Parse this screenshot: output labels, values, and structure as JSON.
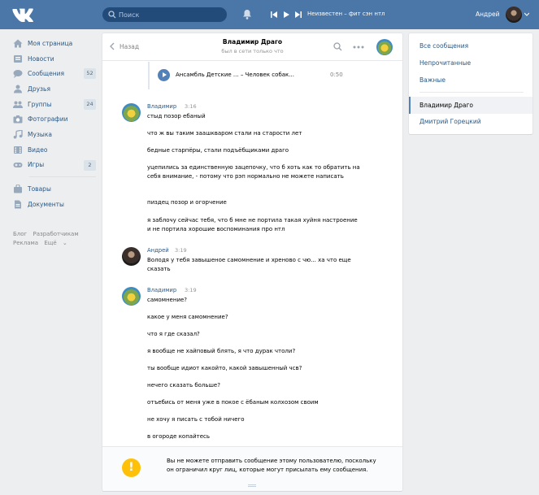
{
  "header": {
    "search_placeholder": "Поиск",
    "now_playing": "Неизвестен – фит сэн нтл",
    "user_name": "Андрей"
  },
  "nav": {
    "items": [
      {
        "label": "Моя страница",
        "icon": "home-icon",
        "count": ""
      },
      {
        "label": "Новости",
        "icon": "news-icon",
        "count": ""
      },
      {
        "label": "Сообщения",
        "icon": "messages-icon",
        "count": "52"
      },
      {
        "label": "Друзья",
        "icon": "friends-icon",
        "count": ""
      },
      {
        "label": "Группы",
        "icon": "groups-icon",
        "count": "24"
      },
      {
        "label": "Фотографии",
        "icon": "camera-icon",
        "count": ""
      },
      {
        "label": "Музыка",
        "icon": "music-icon",
        "count": ""
      },
      {
        "label": "Видео",
        "icon": "video-icon",
        "count": ""
      },
      {
        "label": "Игры",
        "icon": "gamepad-icon",
        "count": "2"
      }
    ],
    "items2": [
      {
        "label": "Товары",
        "icon": "bag-icon"
      },
      {
        "label": "Документы",
        "icon": "document-icon"
      }
    ],
    "footer": {
      "blog": "Блог",
      "developers": "Разработчикам",
      "ads": "Реклама",
      "more": "Ещё"
    }
  },
  "chat": {
    "back_label": "Назад",
    "peer_name": "Владимир Драго",
    "peer_status": "был в сети только что",
    "audio": {
      "title": "Ансамбль Детские ... – Человек собак...",
      "duration": "0:50"
    },
    "groups": [
      {
        "author": "Владимир",
        "time": "3:16",
        "avatar": "ava-vl",
        "messages": [
          "стыд позор ебаный",
          "что ж вы таким заашкваром стали на старости лет",
          "бедные старпёры, стали подъёбщиками драго",
          "уцепились за единственную зацепочку, что б хоть как то обратить на себя внимание, - потому что рэп нормально не можете написать",
          "пиздец позор и огорчение",
          "я заблочу сейчас тебя, что б мне не портила такая хуйня настроение и не портила хорошие воспоминания про нтл"
        ]
      },
      {
        "author": "Андрей",
        "time": "3:19",
        "avatar": "ava-an",
        "messages": [
          "Володя у тебя завышеное самомнение и хреново с чю... ха что еще сказать"
        ]
      },
      {
        "author": "Владимир",
        "time": "3:19",
        "avatar": "ava-vl",
        "messages": [
          "самомнение?",
          "какое у меня самомнение?",
          "что я где сказал?",
          "я вообще не хайповый блять, я что дурак чтоли?",
          "ты вообще идиот какойто, какой завышенный чсв?",
          "нечего сказать больше?",
          "отъебись от меня уже в покое с ёбаным колхозом своим",
          "не хочу я писать с тобой ничего",
          "в огороде копайтесь"
        ]
      }
    ],
    "notice": "Вы не можете отправить сообщение этому пользователю, поскольку он ограничил круг лиц, которые могут присылать ему сообщения."
  },
  "filters": {
    "all": "Все сообщения",
    "unread": "Непрочитанные",
    "important": "Важные",
    "conversations": [
      "Владимир Драго",
      "Дмитрий Горецкий"
    ]
  },
  "colors": {
    "header": "#4a76a8",
    "link": "#2a5885",
    "accent": "#5181b8",
    "warning": "#ffc107"
  }
}
